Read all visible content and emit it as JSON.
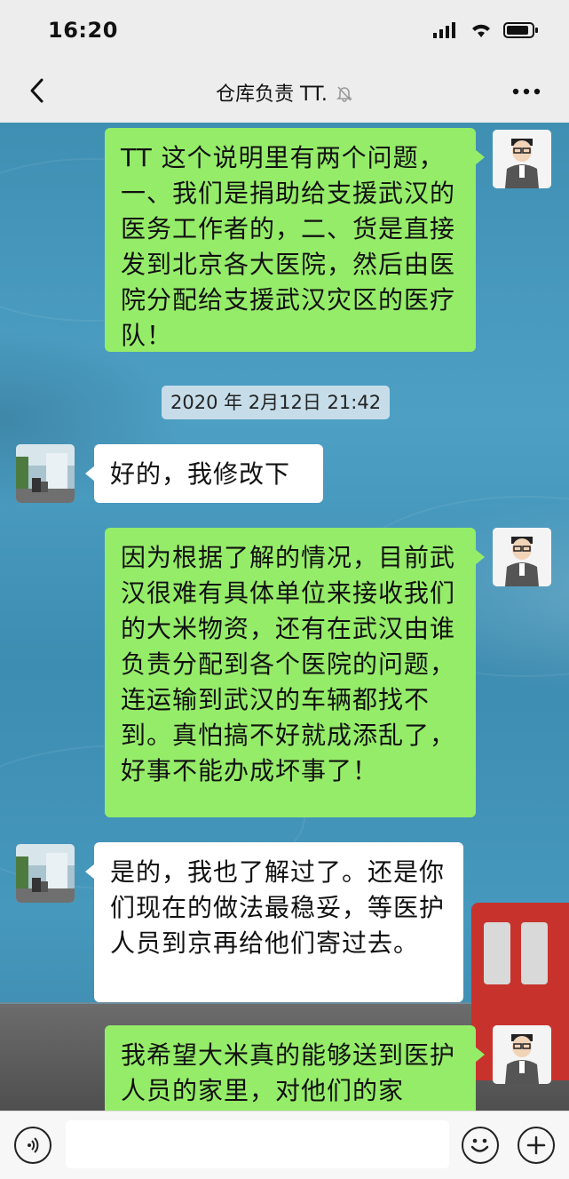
{
  "status_bar": {
    "time": "16:20"
  },
  "nav": {
    "title": "仓库负责 TT.",
    "muted_icon": "bell-off-icon"
  },
  "messages": [
    {
      "sender": "me",
      "text": "TT 这个说明里有两个问题，一、我们是捐助给支援武汉的医务工作者的，二、货是直接发到北京各大医院，然后由医院分配给支援武汉灾区的医疗队！"
    },
    {
      "sender": "them",
      "text": "好的，我修改下"
    },
    {
      "sender": "me",
      "text": "因为根据了解的情况，目前武汉很难有具体单位来接收我们的大米物资，还有在武汉由谁负责分配到各个医院的问题，连运输到武汉的车辆都找不到。真怕搞不好就成添乱了，好事不能办成坏事了！"
    },
    {
      "sender": "them",
      "text": "是的，我也了解过了。还是你们现在的做法最稳妥，等医护人员到京再给他们寄过去。"
    },
    {
      "sender": "me",
      "text": "我希望大米真的能够送到医护人员的家里，对他们的家"
    }
  ],
  "timestamp": "2020 年 2月12日 21:42",
  "input_bar": {
    "voice_icon": "voice-icon",
    "emoji_icon": "emoji-icon",
    "plus_icon": "plus-icon",
    "placeholder": ""
  }
}
